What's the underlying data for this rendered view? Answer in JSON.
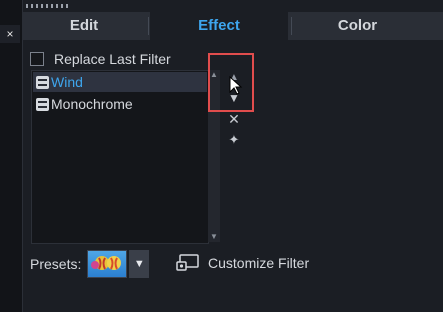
{
  "left_panel": {
    "close_glyph": "×"
  },
  "tabs": [
    {
      "label": "Edit"
    },
    {
      "label": "Effect"
    },
    {
      "label": "Color"
    }
  ],
  "active_tab": "Effect",
  "replace_last_filter": {
    "label": "Replace Last Filter",
    "checked": false
  },
  "filters": [
    {
      "label": "Wind",
      "selected": true
    },
    {
      "label": "Monochrome",
      "selected": false
    }
  ],
  "side_buttons": {
    "move_up_glyph": "▲",
    "move_down_glyph": "▼",
    "remove_glyph": "✕",
    "reset_glyph": "✦"
  },
  "presets": {
    "label": "Presets:",
    "dropdown_glyph": "▼"
  },
  "customize": {
    "label": "Customize Filter"
  },
  "colors": {
    "accent": "#3ea6ee",
    "highlight": "#e14d4d",
    "background": "#1b1e24"
  }
}
